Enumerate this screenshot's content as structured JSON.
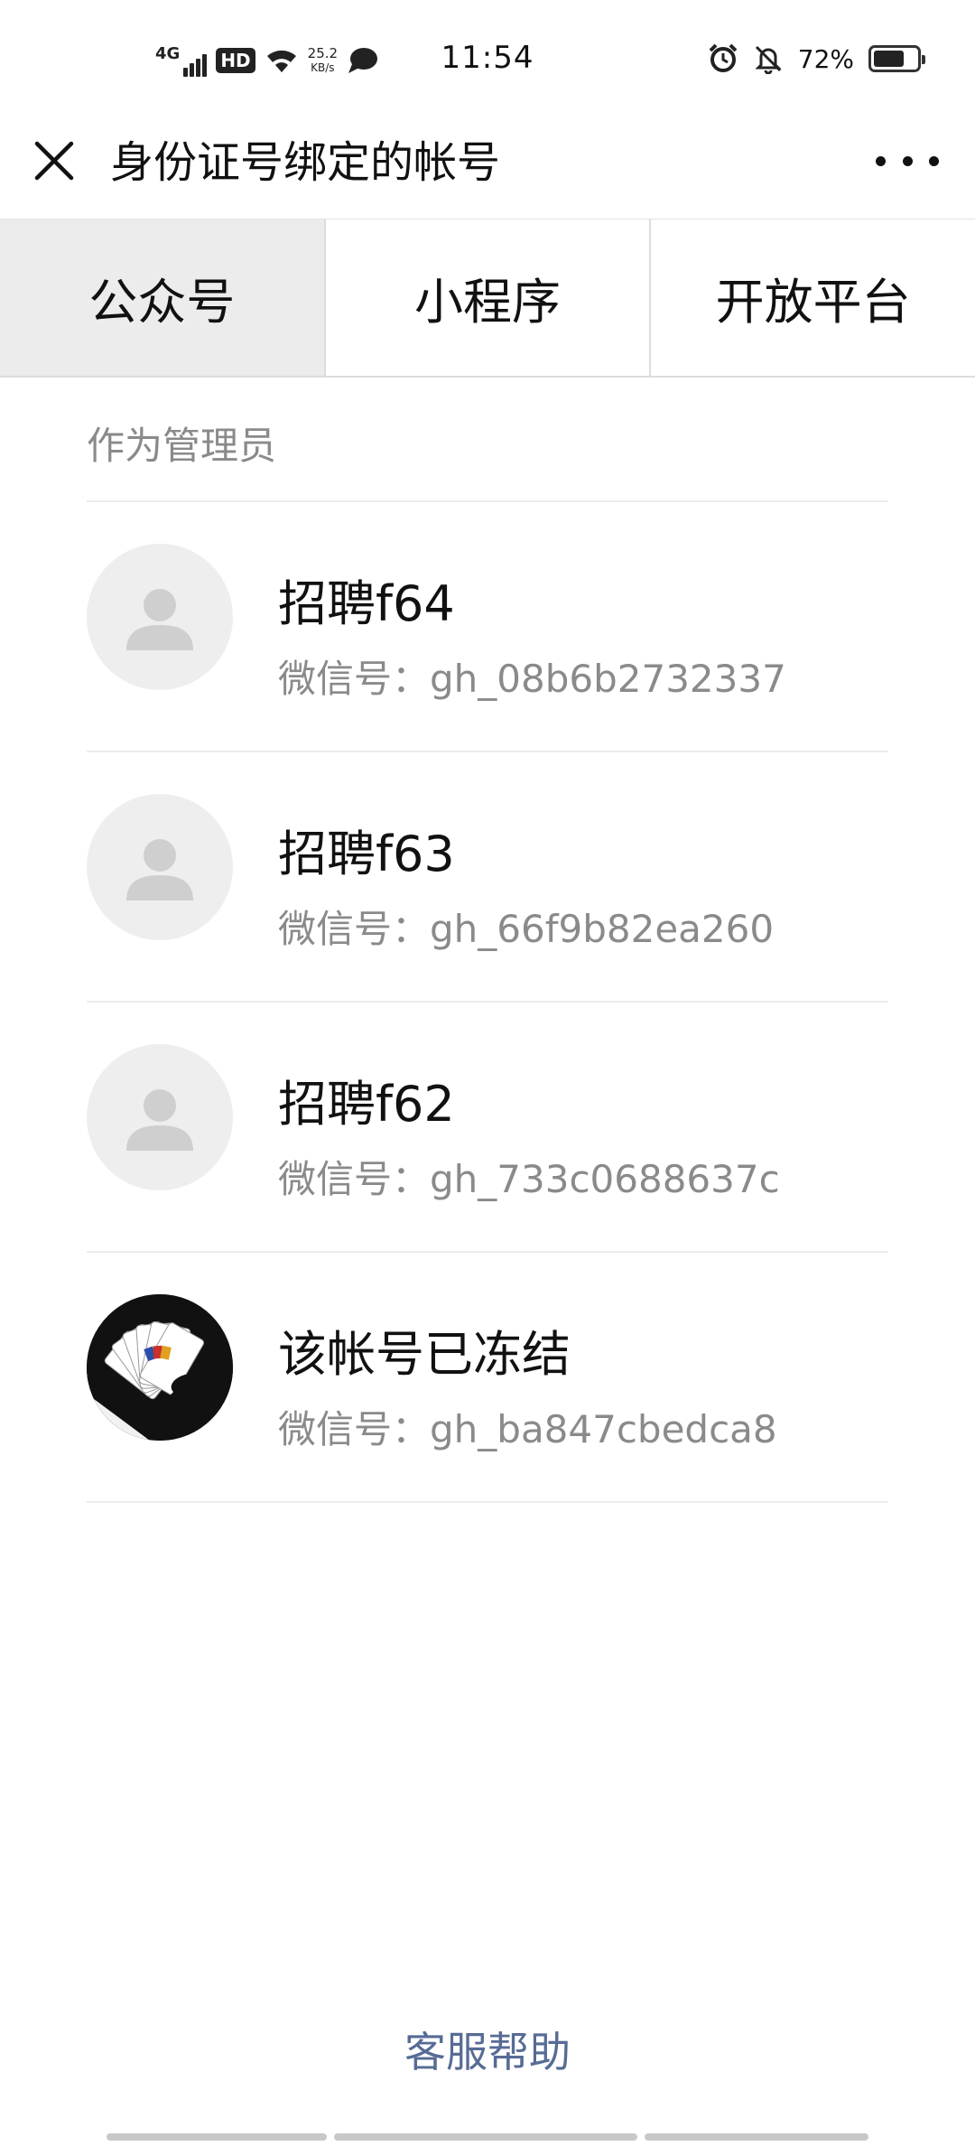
{
  "status_bar": {
    "network": "4G",
    "hd": "HD",
    "speed_value": "25.2",
    "speed_unit": "KB/s",
    "time": "11:54",
    "battery": "72%",
    "battery_level": 0.72
  },
  "header": {
    "title": "身份证号绑定的帐号"
  },
  "tabs": [
    {
      "label": "公众号",
      "active": true
    },
    {
      "label": "小程序",
      "active": false
    },
    {
      "label": "开放平台",
      "active": false
    }
  ],
  "section": {
    "title": "作为管理员"
  },
  "accounts": [
    {
      "name": "招聘f64",
      "wechat_id": "微信号：gh_08b6b2732337",
      "avatar": "default-avatar-icon"
    },
    {
      "name": "招聘f63",
      "wechat_id": "微信号：gh_66f9b82ea260",
      "avatar": "default-avatar-icon"
    },
    {
      "name": "招聘f62",
      "wechat_id": "微信号：gh_733c0688637c",
      "avatar": "default-avatar-icon"
    },
    {
      "name": "该帐号已冻结",
      "wechat_id": "微信号：gh_ba847cbedca8",
      "avatar": "playing-cards-avatar"
    }
  ],
  "footer": {
    "help": "客服帮助"
  },
  "colors": {
    "link": "#576b95",
    "secondary_text": "#8a8a8a",
    "active_tab_bg": "#ececec"
  }
}
